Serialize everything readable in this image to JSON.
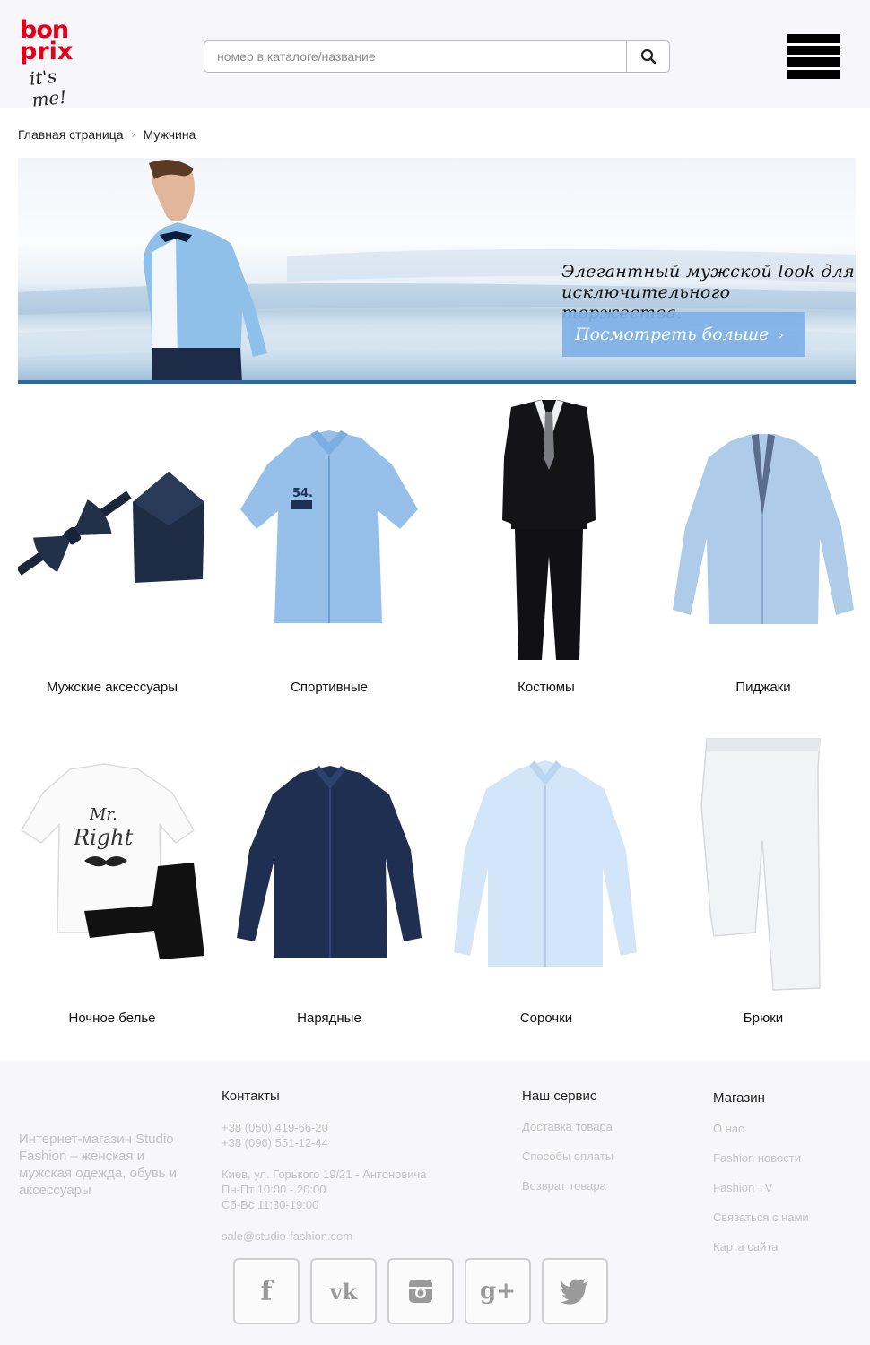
{
  "header": {
    "logo": {
      "line1": "bon",
      "line2": "prix",
      "tagline": "it's me!"
    },
    "search": {
      "placeholder": "номер в каталоге/название"
    },
    "icons": {
      "search": "search-icon",
      "menu": "hamburger-menu-icon"
    }
  },
  "breadcrumb": {
    "items": [
      "Главная страница",
      "Мужчина"
    ],
    "separator": "›"
  },
  "banner": {
    "headline_line1": "Элегантный мужской look для",
    "headline_line2": "исключительного торжества.",
    "button_label": "Посмотреть больше",
    "button_icon": "chevron-right-icon"
  },
  "categories": [
    {
      "label": "Мужские аксессуары"
    },
    {
      "label": "Спортивные"
    },
    {
      "label": "Костюмы"
    },
    {
      "label": "Пиджаки"
    },
    {
      "label": "Ночное белье"
    },
    {
      "label": "Нарядные"
    },
    {
      "label": "Сорочки"
    },
    {
      "label": "Брюки"
    }
  ],
  "footer": {
    "about": "Интернет-магазин Studio Fashion – женская и мужская одежда, обувь и аксессуары",
    "contacts": {
      "title": "Контакты",
      "phone1": "+38 (050) 419-66-20",
      "phone2": "+38 (096) 551-12-44",
      "address": "Киев, ул. Горького 19/21 - Антоновича",
      "hours_weekdays": "Пн-Пт 10:00 - 20:00",
      "hours_weekend": "Сб-Вс 11:30-19:00",
      "email": "sale@studio-fashion.com"
    },
    "service": {
      "title": "Наш сервис",
      "links": [
        "Доставка товара",
        "Способы оплаты",
        "Возврат товара"
      ]
    },
    "shop": {
      "title": "Магазин",
      "links": [
        "О нас",
        "Fashion новости",
        "Fashion TV",
        "Связаться с нами",
        "Карта сайта"
      ]
    },
    "social": [
      "facebook-icon",
      "vk-icon",
      "instagram-icon",
      "google-plus-icon",
      "twitter-icon"
    ]
  },
  "colors": {
    "brand_red": "#e2001a",
    "banner_button": "#7fb1e8",
    "footer_bg": "#f7f6f8"
  }
}
